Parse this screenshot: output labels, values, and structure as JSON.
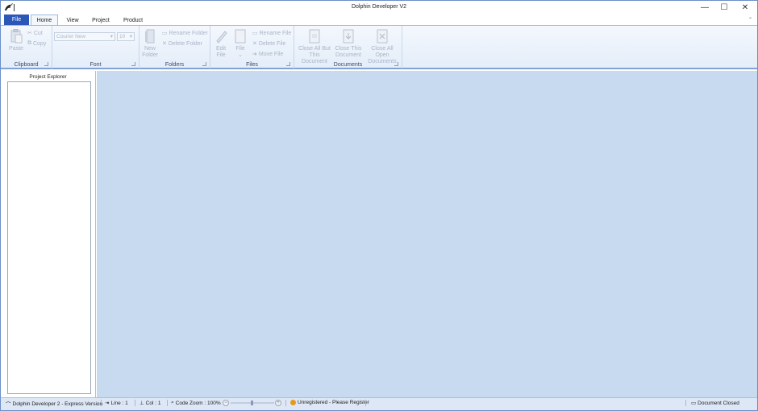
{
  "window": {
    "title": "Dolphin Developer V2",
    "minimize_glyph": "—",
    "maximize_glyph": "☐",
    "close_glyph": "✕"
  },
  "tabs": [
    {
      "label": "File"
    },
    {
      "label": "Home"
    },
    {
      "label": "View"
    },
    {
      "label": "Project"
    },
    {
      "label": "Product"
    }
  ],
  "ribbon": {
    "clipboard": {
      "label": "Clipboard",
      "paste": "Paste",
      "cut": "Cut",
      "copy": "Copy"
    },
    "font": {
      "label": "Font",
      "family_value": "Courier New",
      "size_value": "10"
    },
    "folders": {
      "label": "Folders",
      "new_folder_line1": "New",
      "new_folder_line2": "Folder",
      "rename_folder": "Rename Folder",
      "delete_folder": "Delete Folder"
    },
    "files": {
      "label": "Files",
      "edit_file_line1": "Edit",
      "edit_file_line2": "File",
      "file_line1": "File",
      "file_line2": "⌄",
      "rename_file": "Rename File",
      "delete_file": "Delete File",
      "move_file": "Move File"
    },
    "documents": {
      "label": "Documents",
      "close_all_but_line1": "Close All But",
      "close_all_but_line2": "This Document",
      "close_this_line1": "Close This",
      "close_this_line2": "Document",
      "close_all_line1": "Close All Open",
      "close_all_line2": "Documents"
    }
  },
  "explorer": {
    "title": "Project Explorer"
  },
  "statusbar": {
    "app_version": "Dolphin Developer 2 - Express Version",
    "line": "Line : 1",
    "col": "Col : 1",
    "zoom": "Code Zoom : 100%",
    "zoom_minus": "−",
    "zoom_plus": "+",
    "registration": "Unregistered - Please Register",
    "doc_status": "Document Closed"
  },
  "colors": {
    "file_tab": "#2b57b9",
    "workspace": "#c8daf0",
    "ribbon_border": "#7ea2d6",
    "status_bg": "#dde7f5"
  }
}
